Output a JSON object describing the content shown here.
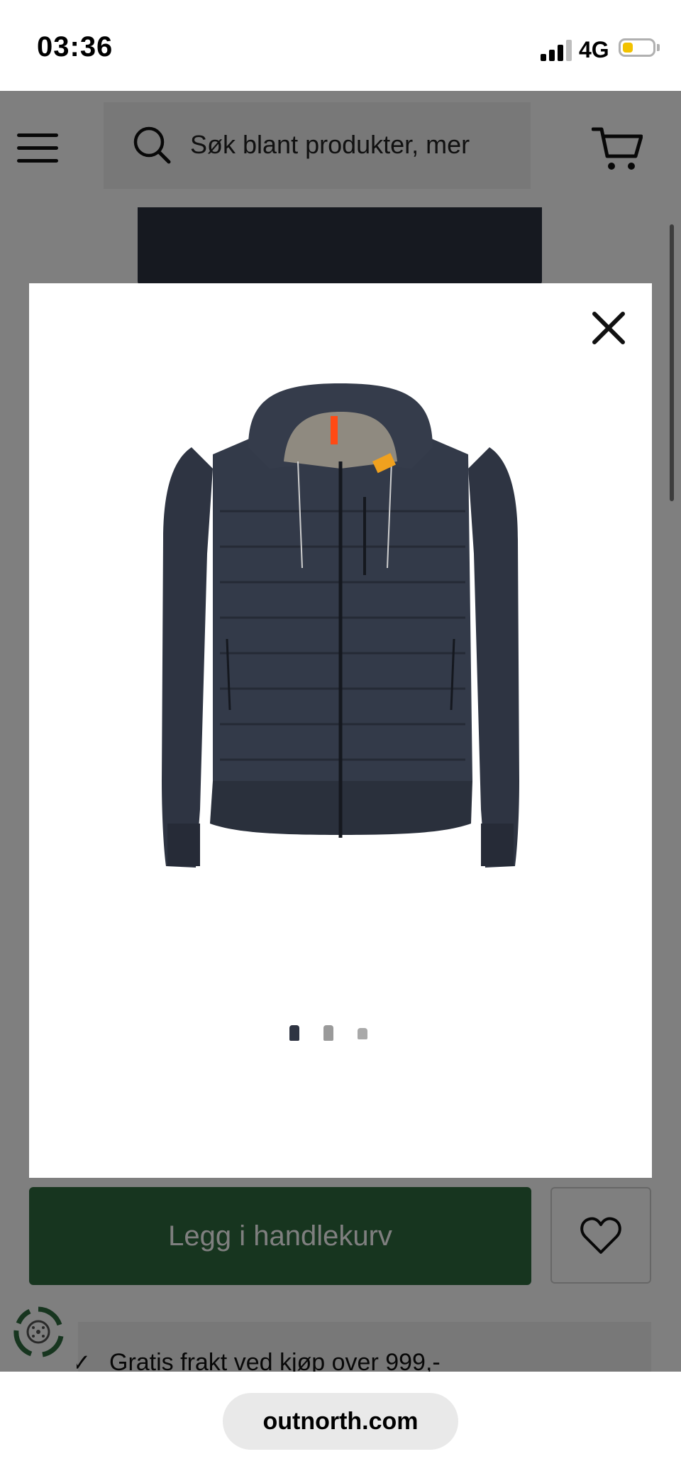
{
  "status_bar": {
    "time": "03:36",
    "network": "4G",
    "battery_color": "#f2c200"
  },
  "header": {
    "menu_icon": "hamburger-menu-icon",
    "search": {
      "placeholder": "Søk blant produkter, mer",
      "icon": "search-icon"
    },
    "cart_icon": "shopping-cart-icon"
  },
  "modal": {
    "close_icon": "close-icon",
    "image_alt": "Navy hooded quilted jacket",
    "thumbnails": {
      "count": 3,
      "active_index": 0
    }
  },
  "product_actions": {
    "add_to_cart_label": "Legg i handlekurv",
    "wishlist_icon": "heart-icon",
    "accent_color": "#2f6b3f"
  },
  "info": {
    "shipping_text": "Gratis frakt ved kjøp over 999,-"
  },
  "eco_badge": {
    "icon": "recycle-eco-icon"
  },
  "browser": {
    "url": "outnorth.com"
  }
}
